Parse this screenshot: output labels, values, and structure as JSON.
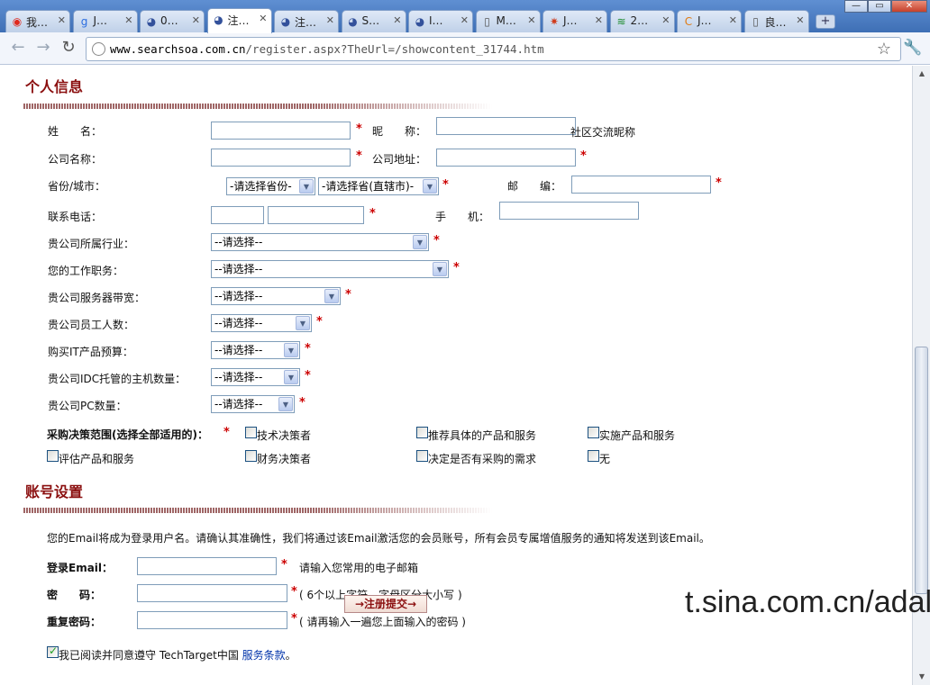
{
  "browser": {
    "tabs": [
      {
        "icon": "weibo-icon",
        "glyph": "◉",
        "color": "#e0291e",
        "label": "我…"
      },
      {
        "icon": "google-icon",
        "glyph": "g",
        "color": "#2a6de0",
        "label": "J…"
      },
      {
        "icon": "eye-icon",
        "glyph": "◕",
        "color": "#33519b",
        "label": "0…"
      },
      {
        "icon": "eye-icon",
        "glyph": "◕",
        "color": "#33519b",
        "label": "注…"
      },
      {
        "icon": "eye-icon",
        "glyph": "◕",
        "color": "#33519b",
        "label": "注…"
      },
      {
        "icon": "eye-icon",
        "glyph": "◕",
        "color": "#33519b",
        "label": "S…"
      },
      {
        "icon": "eye-icon",
        "glyph": "◕",
        "color": "#33519b",
        "label": "I…"
      },
      {
        "icon": "page-icon",
        "glyph": "▯",
        "color": "#555",
        "label": "M…"
      },
      {
        "icon": "sun-icon",
        "glyph": "✷",
        "color": "#d03a1a",
        "label": "J…"
      },
      {
        "icon": "s-icon",
        "glyph": "≋",
        "color": "#1b8a2c",
        "label": "2…"
      },
      {
        "icon": "c-icon",
        "glyph": "C",
        "color": "#e07b12",
        "label": "J…"
      },
      {
        "icon": "page-icon",
        "glyph": "▯",
        "color": "#555",
        "label": "良…"
      }
    ],
    "active_tab": 3,
    "url_host": "www.searchsoa.com.cn",
    "url_rest": "/register.aspx?TheUrl=/showcontent_31744.htm"
  },
  "personal": {
    "title": "个人信息",
    "name_label": "姓　　名：",
    "nickname_label": "昵　　称：",
    "nickname_hint": "社区交流昵称",
    "company_label": "公司名称：",
    "address_label": "公司地址：",
    "province_label": "省份/城市：",
    "province_select": "-请选择省份-",
    "city_select": "-请选择省(直辖市)-",
    "zip_label": "邮　　编：",
    "phone_label": "联系电话：",
    "mobile_label": "手　　机：",
    "industry_label": "贵公司所属行业：",
    "job_label": "您的工作职务：",
    "bandwidth_label": "贵公司服务器带宽：",
    "employees_label": "贵公司员工人数：",
    "budget_label": "购买IT产品预算：",
    "idc_label": "贵公司IDC托管的主机数量：",
    "pc_label": "贵公司PC数量：",
    "select_placeholder": "--请选择--",
    "required_mark": "*",
    "purchase_label": "采购决策范围(选择全部适用的)：",
    "purchase_options": [
      "技术决策者",
      "推荐具体的产品和服务",
      "实施产品和服务",
      "评估产品和服务",
      "财务决策者",
      "决定是否有采购的需求",
      "无"
    ]
  },
  "account": {
    "title": "账号设置",
    "note": "您的Email将成为登录用户名。请确认其准确性，我们将通过该Email激活您的会员账号，所有会员专属增值服务的通知将发送到该Email。",
    "email_label": "登录Email：",
    "email_hint": "请输入您常用的电子邮箱",
    "password_label": "密　　码：",
    "password_hint": "( 6个以上字符，字母区分大小写 )",
    "confirm_label": "重复密码：",
    "confirm_hint": "( 请再输入一遍您上面输入的密码 )",
    "agree_text": "我已阅读并同意遵守 TechTarget中国 ",
    "agree_link": "服务条款",
    "agree_end": "。",
    "agree_checked": true,
    "submit_label": "→注册提交→"
  },
  "watermark": "t.sina.com.cn/adali"
}
